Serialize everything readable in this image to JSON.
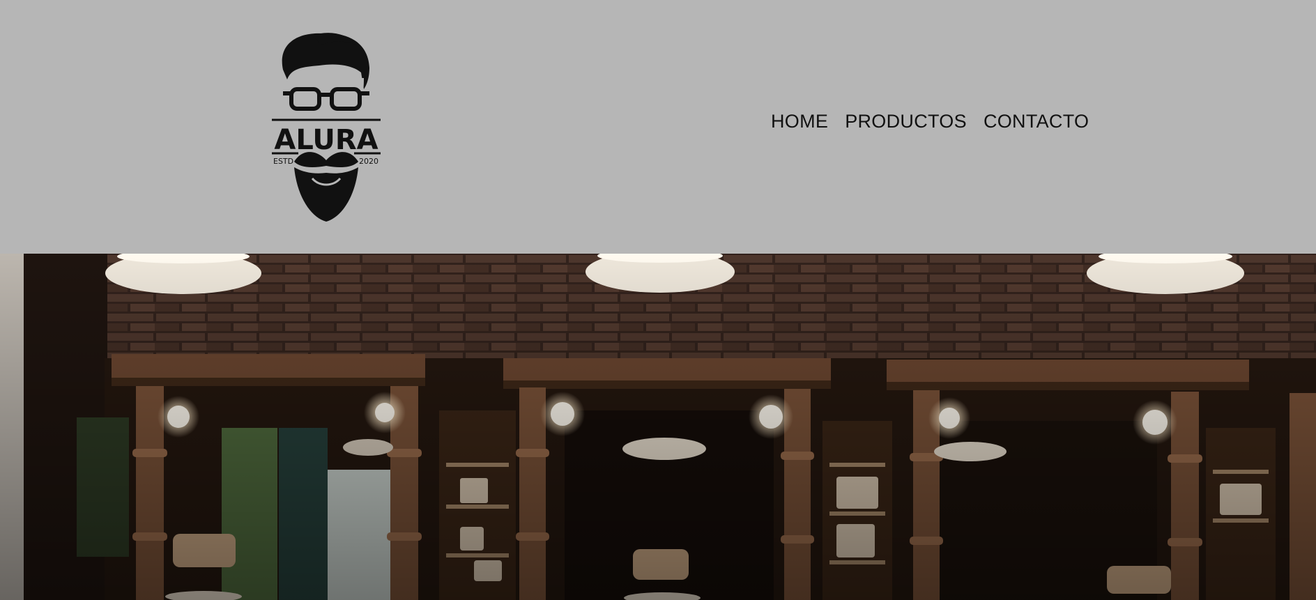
{
  "header": {
    "background_color": "#b6b6b6",
    "logo": {
      "brand": "ALURA",
      "left_text": "ESTD",
      "right_text": "2020",
      "icon": "bearded-man-glasses-logo"
    },
    "nav": {
      "items": [
        {
          "label": "HOME"
        },
        {
          "label": "PRODUCTOS"
        },
        {
          "label": "CONTACTO"
        }
      ]
    }
  },
  "hero": {
    "image": "barbershop-interior-photo",
    "brick_color": "#5b4034",
    "wood_color": "#5a3a26"
  }
}
